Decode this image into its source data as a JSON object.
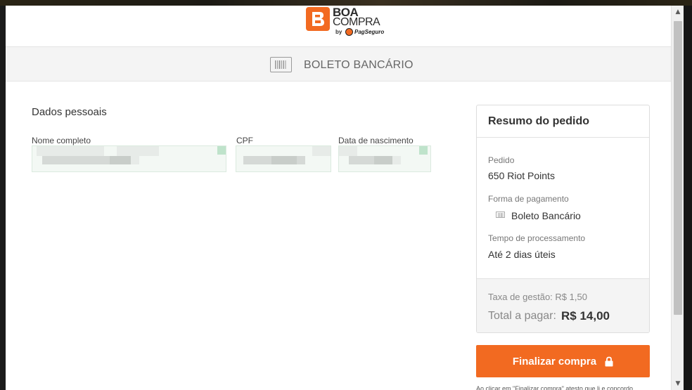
{
  "brand": {
    "name_line1": "BOA",
    "name_line2": "COMPRA",
    "by": "by",
    "partner": "PagSeguro",
    "accent_color": "#f26a21"
  },
  "method_bar": {
    "icon": "barcode-icon",
    "title": "BOLETO BANCÁRIO"
  },
  "personal": {
    "title": "Dados pessoais",
    "fields": [
      {
        "label": "Nome completo",
        "value": ""
      },
      {
        "label": "CPF",
        "value": ""
      },
      {
        "label": "Data de nascimento",
        "value": ""
      }
    ]
  },
  "summary": {
    "title": "Resumo do pedido",
    "order_label": "Pedido",
    "order_value": "650 Riot Points",
    "payment_label": "Forma de pagamento",
    "payment_icon": "barcode-icon",
    "payment_value": "Boleto Bancário",
    "processing_label": "Tempo de processamento",
    "processing_value": "Até 2 dias úteis",
    "fee": "Taxa de gestão: R$ 1,50",
    "total_label": "Total a pagar:",
    "total_value": "R$ 14,00"
  },
  "actions": {
    "finalize_label": "Finalizar compra",
    "finalize_icon": "lock-icon",
    "terms": "Ao clicar em \"Finalizar compra\" atesto que li e concordo"
  },
  "scrollbar": {
    "up_icon": "scroll-up-icon",
    "down_icon": "scroll-down-icon",
    "thumb_color": "#c1c1c1"
  }
}
